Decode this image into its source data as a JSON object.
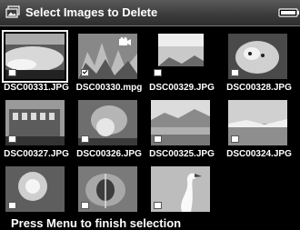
{
  "header": {
    "title": "Select Images to Delete",
    "icon": "folder-images-icon",
    "battery_icon": "battery-icon"
  },
  "images": [
    {
      "filename": "DSC00331.JPG",
      "selected": true,
      "checked": false,
      "type": "photo"
    },
    {
      "filename": "DSC00330.mpg",
      "selected": false,
      "checked": true,
      "type": "movie"
    },
    {
      "filename": "DSC00329.JPG",
      "selected": false,
      "checked": false,
      "type": "photo"
    },
    {
      "filename": "DSC00328.JPG",
      "selected": false,
      "checked": false,
      "type": "photo"
    },
    {
      "filename": "DSC00327.JPG",
      "selected": false,
      "checked": false,
      "type": "photo"
    },
    {
      "filename": "DSC00326.JPG",
      "selected": false,
      "checked": false,
      "type": "photo"
    },
    {
      "filename": "DSC00325.JPG",
      "selected": false,
      "checked": false,
      "type": "photo"
    },
    {
      "filename": "DSC00324.JPG",
      "selected": false,
      "checked": false,
      "type": "photo"
    },
    {
      "filename": "",
      "selected": false,
      "checked": false,
      "type": "photo"
    },
    {
      "filename": "",
      "selected": false,
      "checked": false,
      "type": "photo"
    },
    {
      "filename": "",
      "selected": false,
      "checked": false,
      "type": "photo"
    }
  ],
  "status": {
    "instruction": "Press Menu to finish selection"
  },
  "colors": {
    "background": "#000000",
    "title_bar": "#3c3c3c",
    "text": "#ffffff"
  }
}
